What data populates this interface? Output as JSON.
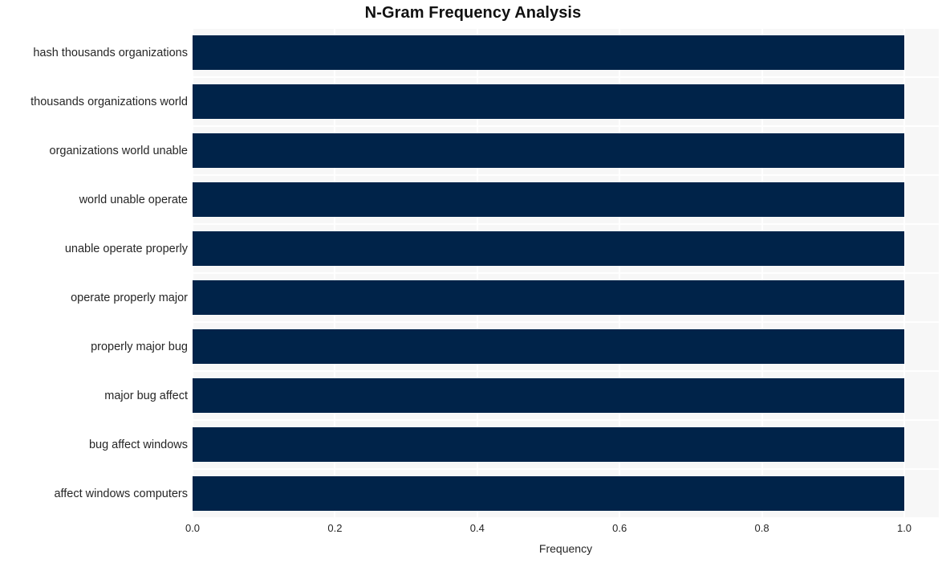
{
  "chart_data": {
    "type": "bar",
    "orientation": "horizontal",
    "title": "N-Gram Frequency Analysis",
    "xlabel": "Frequency",
    "ylabel": "",
    "xlim": [
      0.0,
      1.0
    ],
    "xticks": [
      "0.0",
      "0.2",
      "0.4",
      "0.6",
      "0.8",
      "1.0"
    ],
    "xtick_values": [
      0.0,
      0.2,
      0.4,
      0.6,
      0.8,
      1.0
    ],
    "grid": true,
    "legend": "none",
    "bar_color": "#002349",
    "plot_background": "#f7f7f7",
    "figure_background": "#ffffff",
    "text_color": "#262626",
    "categories": [
      "hash thousands organizations",
      "thousands organizations world",
      "organizations world unable",
      "world unable operate",
      "unable operate properly",
      "operate properly major",
      "properly major bug",
      "major bug affect",
      "bug affect windows",
      "affect windows computers"
    ],
    "values": [
      1.0,
      1.0,
      1.0,
      1.0,
      1.0,
      1.0,
      1.0,
      1.0,
      1.0,
      1.0
    ]
  }
}
